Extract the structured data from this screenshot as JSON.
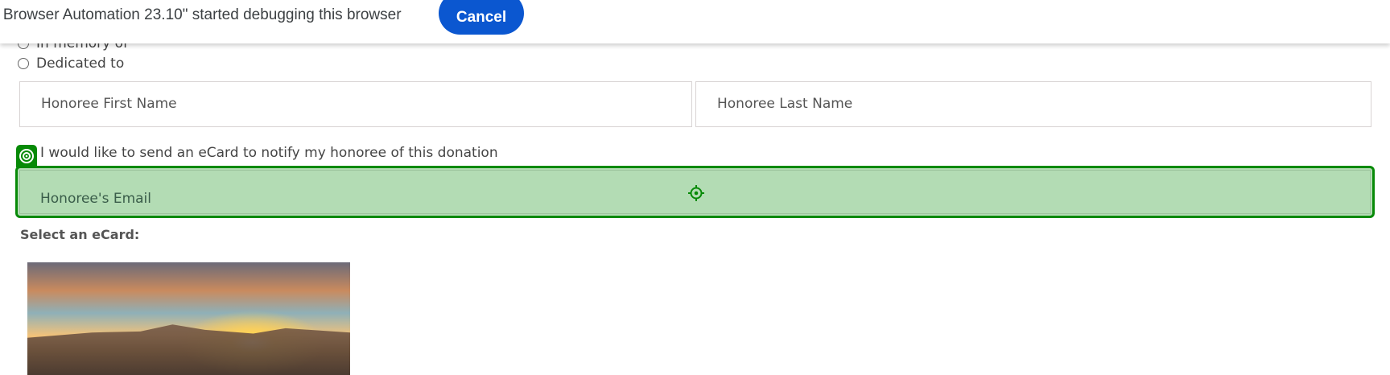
{
  "infobar": {
    "message": "n Browser Automation 23.10\" started debugging this browser",
    "cancel_label": "Cancel"
  },
  "form": {
    "radio_in_memory": "In memory of",
    "radio_dedicated": "Dedicated to",
    "first_name_placeholder": "Honoree First Name",
    "last_name_placeholder": "Honoree Last Name",
    "ecard_checkbox_label": "I would like to send an eCard to notify my honoree of this donation",
    "email_placeholder": "Honoree's Email",
    "select_ecard_label": "Select an eCard:"
  },
  "colors": {
    "highlight": "#078a07",
    "highlight_fill": "#b3dcb4",
    "cancel": "#0b57d0"
  }
}
